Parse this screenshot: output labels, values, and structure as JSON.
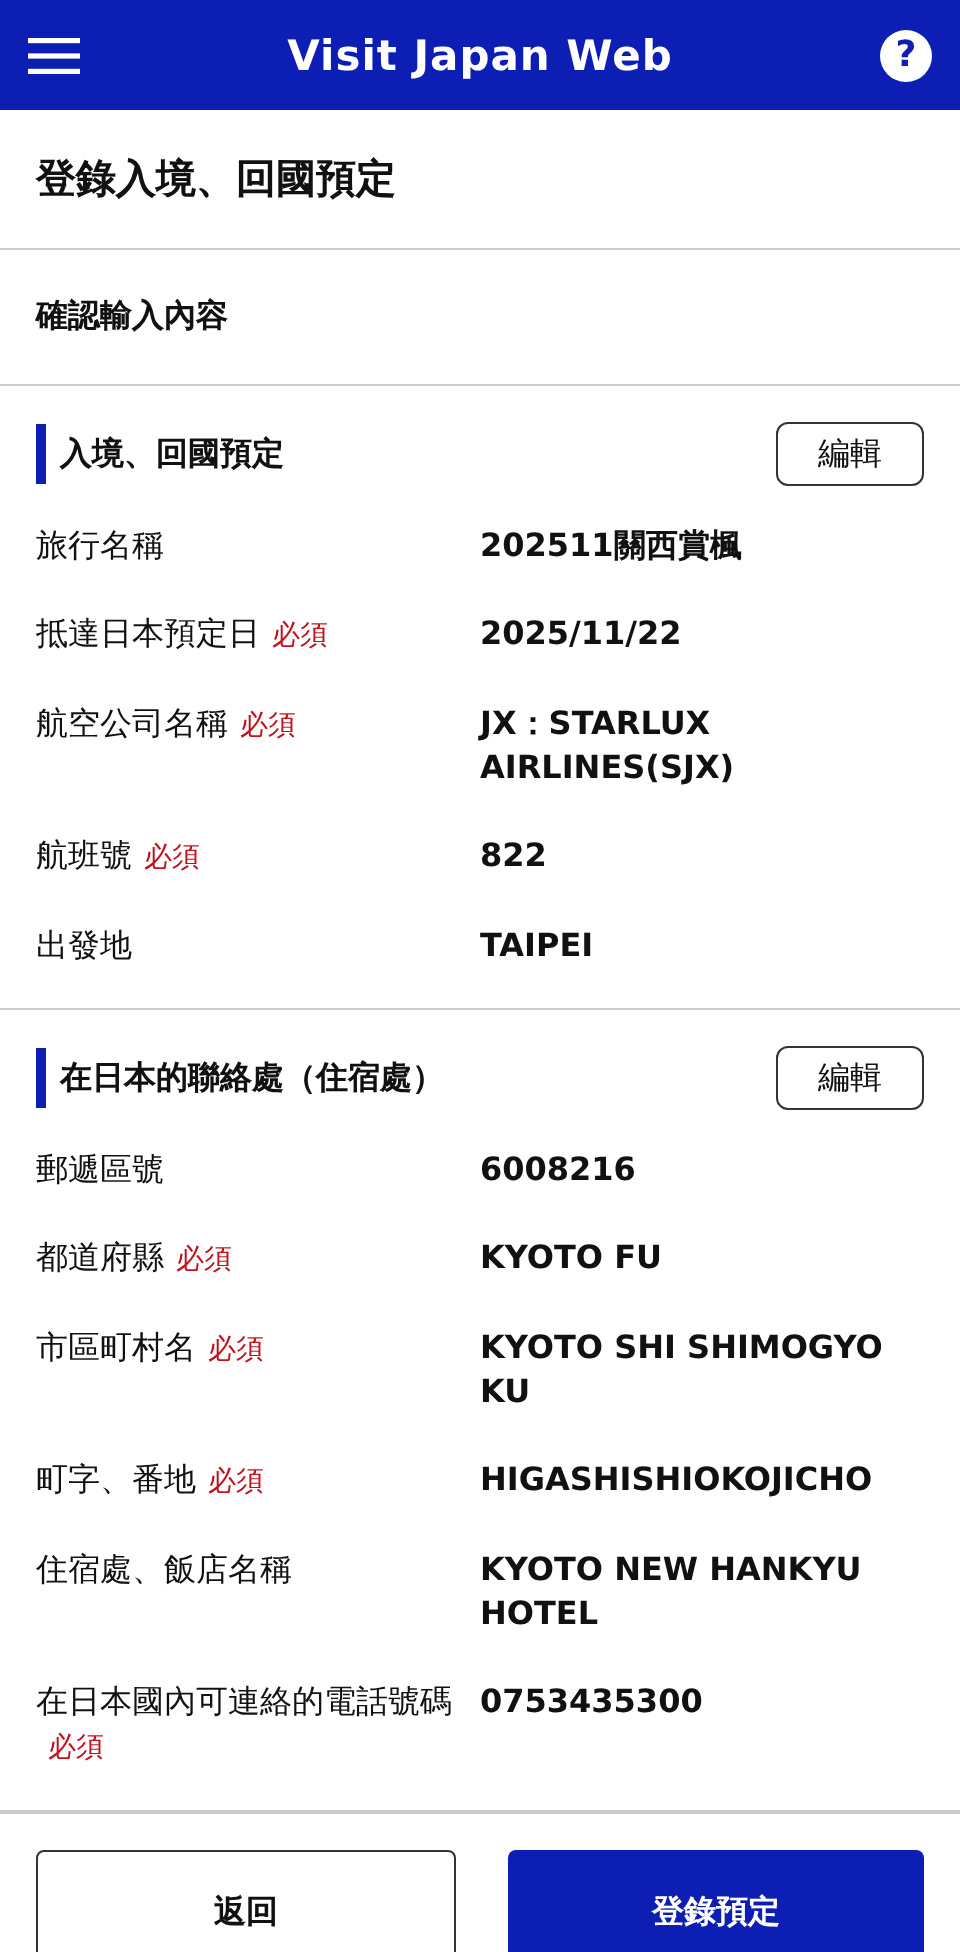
{
  "header": {
    "title": "Visit Japan Web",
    "help": "?"
  },
  "page_title": "登錄入境、回國預定",
  "subtitle": "確認輸入內容",
  "sections": [
    {
      "title": "入境、回國預定",
      "edit_button": "編輯",
      "rows": [
        {
          "label": "旅行名稱",
          "value": "202511關西賞楓"
        },
        {
          "label": "抵達日本預定日",
          "tag": "必須",
          "value": "2025/11/22"
        },
        {
          "label": "航空公司名稱",
          "tag": "必須",
          "value": "JX：STARLUX AIRLINES(SJX)"
        },
        {
          "label": "航班號",
          "tag": "必須",
          "value": "822"
        },
        {
          "label": "出發地",
          "value": "TAIPEI"
        }
      ]
    },
    {
      "title": "在日本的聯絡處（住宿處）",
      "edit_button": "編輯",
      "rows": [
        {
          "label": "郵遞區號",
          "value": "6008216"
        },
        {
          "label": "都道府縣",
          "tag": "必須",
          "value": "KYOTO FU"
        },
        {
          "label": "市區町村名",
          "tag": "必須",
          "value": "KYOTO SHI SHIMOGYO KU"
        },
        {
          "label": "町字、番地",
          "tag": "必須",
          "value": "HIGASHISHIOKOJICHO"
        },
        {
          "label": "住宿處、飯店名稱",
          "value": "KYOTO NEW HANKYU HOTEL"
        },
        {
          "label": "在日本國內可連絡的電話號碼",
          "tag": "必須",
          "value": "0753435300"
        }
      ]
    }
  ],
  "buttons": [
    {
      "label": "返回",
      "kind": "secondary"
    },
    {
      "label": "登錄預定",
      "kind": "primary"
    }
  ]
}
